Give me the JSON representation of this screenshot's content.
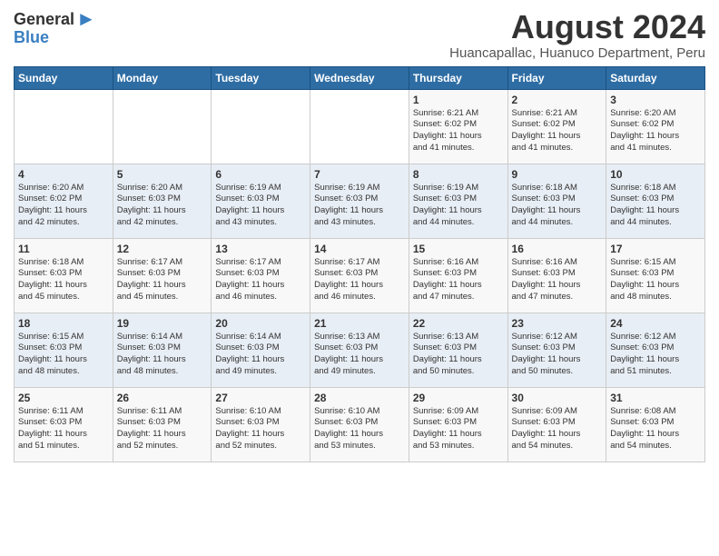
{
  "logo": {
    "general": "General",
    "blue": "Blue"
  },
  "title": "August 2024",
  "subtitle": "Huancapallac, Huanuco Department, Peru",
  "days_of_week": [
    "Sunday",
    "Monday",
    "Tuesday",
    "Wednesday",
    "Thursday",
    "Friday",
    "Saturday"
  ],
  "weeks": [
    [
      {
        "day": "",
        "info": ""
      },
      {
        "day": "",
        "info": ""
      },
      {
        "day": "",
        "info": ""
      },
      {
        "day": "",
        "info": ""
      },
      {
        "day": "1",
        "info": "Sunrise: 6:21 AM\nSunset: 6:02 PM\nDaylight: 11 hours\nand 41 minutes."
      },
      {
        "day": "2",
        "info": "Sunrise: 6:21 AM\nSunset: 6:02 PM\nDaylight: 11 hours\nand 41 minutes."
      },
      {
        "day": "3",
        "info": "Sunrise: 6:20 AM\nSunset: 6:02 PM\nDaylight: 11 hours\nand 41 minutes."
      }
    ],
    [
      {
        "day": "4",
        "info": "Sunrise: 6:20 AM\nSunset: 6:02 PM\nDaylight: 11 hours\nand 42 minutes."
      },
      {
        "day": "5",
        "info": "Sunrise: 6:20 AM\nSunset: 6:03 PM\nDaylight: 11 hours\nand 42 minutes."
      },
      {
        "day": "6",
        "info": "Sunrise: 6:19 AM\nSunset: 6:03 PM\nDaylight: 11 hours\nand 43 minutes."
      },
      {
        "day": "7",
        "info": "Sunrise: 6:19 AM\nSunset: 6:03 PM\nDaylight: 11 hours\nand 43 minutes."
      },
      {
        "day": "8",
        "info": "Sunrise: 6:19 AM\nSunset: 6:03 PM\nDaylight: 11 hours\nand 44 minutes."
      },
      {
        "day": "9",
        "info": "Sunrise: 6:18 AM\nSunset: 6:03 PM\nDaylight: 11 hours\nand 44 minutes."
      },
      {
        "day": "10",
        "info": "Sunrise: 6:18 AM\nSunset: 6:03 PM\nDaylight: 11 hours\nand 44 minutes."
      }
    ],
    [
      {
        "day": "11",
        "info": "Sunrise: 6:18 AM\nSunset: 6:03 PM\nDaylight: 11 hours\nand 45 minutes."
      },
      {
        "day": "12",
        "info": "Sunrise: 6:17 AM\nSunset: 6:03 PM\nDaylight: 11 hours\nand 45 minutes."
      },
      {
        "day": "13",
        "info": "Sunrise: 6:17 AM\nSunset: 6:03 PM\nDaylight: 11 hours\nand 46 minutes."
      },
      {
        "day": "14",
        "info": "Sunrise: 6:17 AM\nSunset: 6:03 PM\nDaylight: 11 hours\nand 46 minutes."
      },
      {
        "day": "15",
        "info": "Sunrise: 6:16 AM\nSunset: 6:03 PM\nDaylight: 11 hours\nand 47 minutes."
      },
      {
        "day": "16",
        "info": "Sunrise: 6:16 AM\nSunset: 6:03 PM\nDaylight: 11 hours\nand 47 minutes."
      },
      {
        "day": "17",
        "info": "Sunrise: 6:15 AM\nSunset: 6:03 PM\nDaylight: 11 hours\nand 48 minutes."
      }
    ],
    [
      {
        "day": "18",
        "info": "Sunrise: 6:15 AM\nSunset: 6:03 PM\nDaylight: 11 hours\nand 48 minutes."
      },
      {
        "day": "19",
        "info": "Sunrise: 6:14 AM\nSunset: 6:03 PM\nDaylight: 11 hours\nand 48 minutes."
      },
      {
        "day": "20",
        "info": "Sunrise: 6:14 AM\nSunset: 6:03 PM\nDaylight: 11 hours\nand 49 minutes."
      },
      {
        "day": "21",
        "info": "Sunrise: 6:13 AM\nSunset: 6:03 PM\nDaylight: 11 hours\nand 49 minutes."
      },
      {
        "day": "22",
        "info": "Sunrise: 6:13 AM\nSunset: 6:03 PM\nDaylight: 11 hours\nand 50 minutes."
      },
      {
        "day": "23",
        "info": "Sunrise: 6:12 AM\nSunset: 6:03 PM\nDaylight: 11 hours\nand 50 minutes."
      },
      {
        "day": "24",
        "info": "Sunrise: 6:12 AM\nSunset: 6:03 PM\nDaylight: 11 hours\nand 51 minutes."
      }
    ],
    [
      {
        "day": "25",
        "info": "Sunrise: 6:11 AM\nSunset: 6:03 PM\nDaylight: 11 hours\nand 51 minutes."
      },
      {
        "day": "26",
        "info": "Sunrise: 6:11 AM\nSunset: 6:03 PM\nDaylight: 11 hours\nand 52 minutes."
      },
      {
        "day": "27",
        "info": "Sunrise: 6:10 AM\nSunset: 6:03 PM\nDaylight: 11 hours\nand 52 minutes."
      },
      {
        "day": "28",
        "info": "Sunrise: 6:10 AM\nSunset: 6:03 PM\nDaylight: 11 hours\nand 53 minutes."
      },
      {
        "day": "29",
        "info": "Sunrise: 6:09 AM\nSunset: 6:03 PM\nDaylight: 11 hours\nand 53 minutes."
      },
      {
        "day": "30",
        "info": "Sunrise: 6:09 AM\nSunset: 6:03 PM\nDaylight: 11 hours\nand 54 minutes."
      },
      {
        "day": "31",
        "info": "Sunrise: 6:08 AM\nSunset: 6:03 PM\nDaylight: 11 hours\nand 54 minutes."
      }
    ]
  ]
}
